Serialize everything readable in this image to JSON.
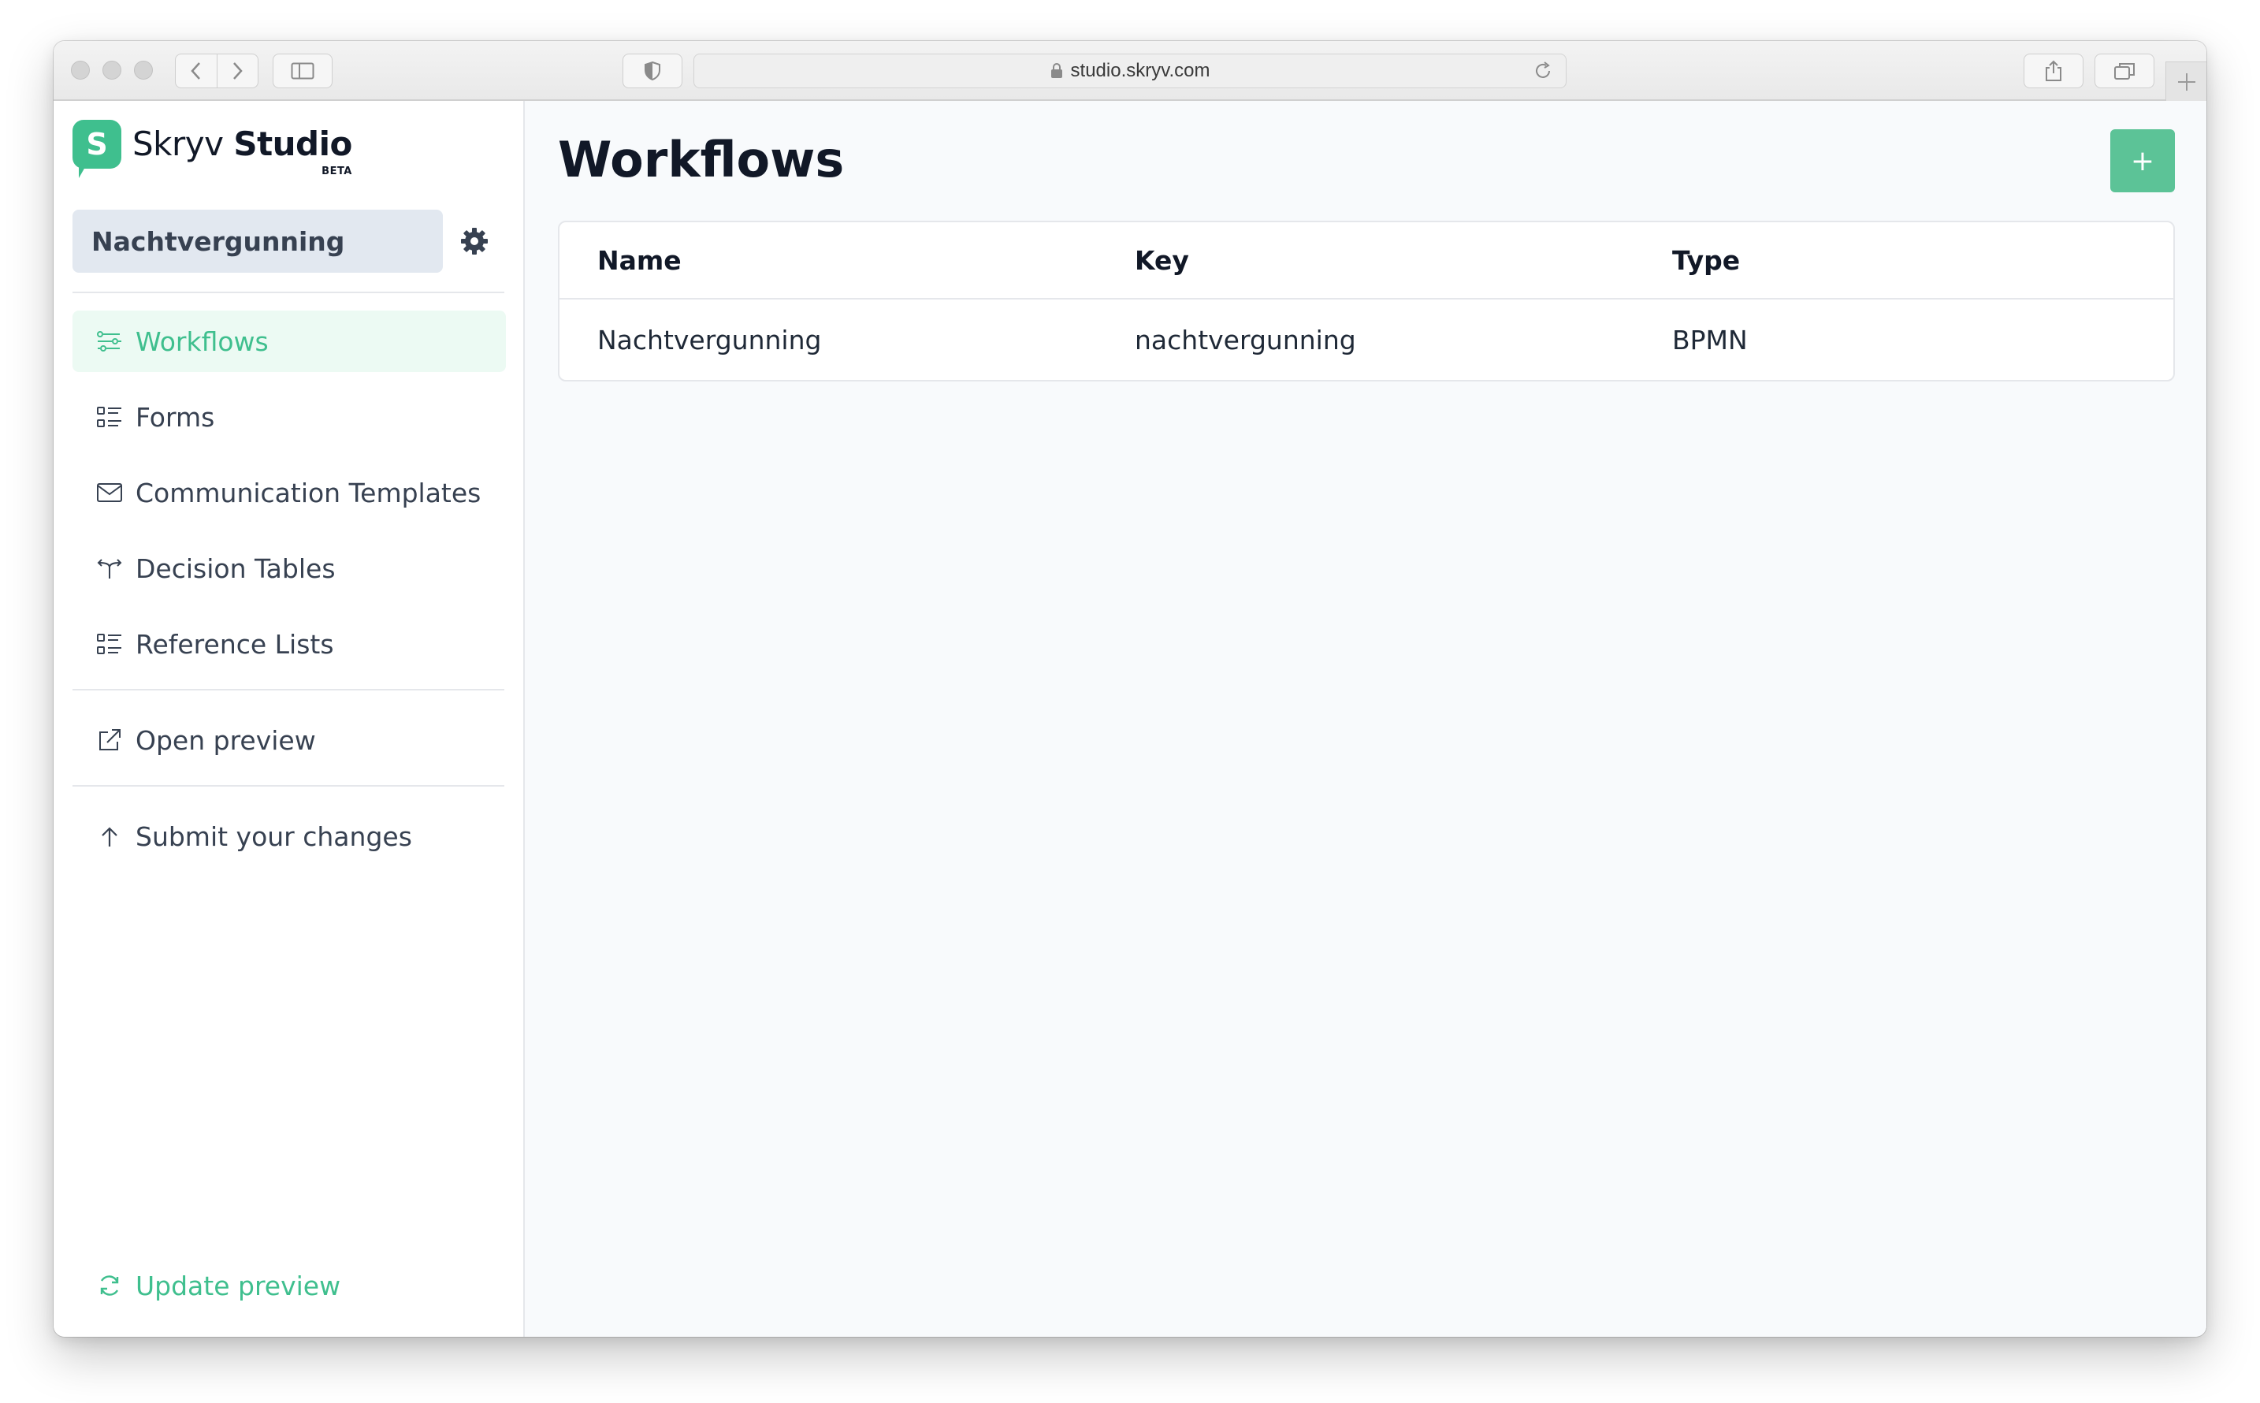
{
  "browser": {
    "url": "studio.skryv.com"
  },
  "brand": {
    "badge_letter": "S",
    "name_regular": "Skryv",
    "name_bold": "Studio",
    "tag": "BETA",
    "accent_color": "#3fbf8e"
  },
  "sidebar": {
    "project": "Nachtvergunning",
    "items": [
      {
        "label": "Workflows",
        "icon": "workflow-icon",
        "active": true
      },
      {
        "label": "Forms",
        "icon": "list-icon"
      },
      {
        "label": "Communication Templates",
        "icon": "envelope-icon"
      },
      {
        "label": "Decision Tables",
        "icon": "decision-icon"
      },
      {
        "label": "Reference Lists",
        "icon": "list-icon"
      }
    ],
    "open_preview": "Open preview",
    "submit_changes": "Submit your changes",
    "update_preview": "Update preview"
  },
  "main": {
    "title": "Workflows",
    "add_button": "+",
    "table": {
      "columns": [
        "Name",
        "Key",
        "Type"
      ],
      "rows": [
        [
          "Nachtvergunning",
          "nachtvergunning",
          "BPMN"
        ]
      ]
    }
  }
}
